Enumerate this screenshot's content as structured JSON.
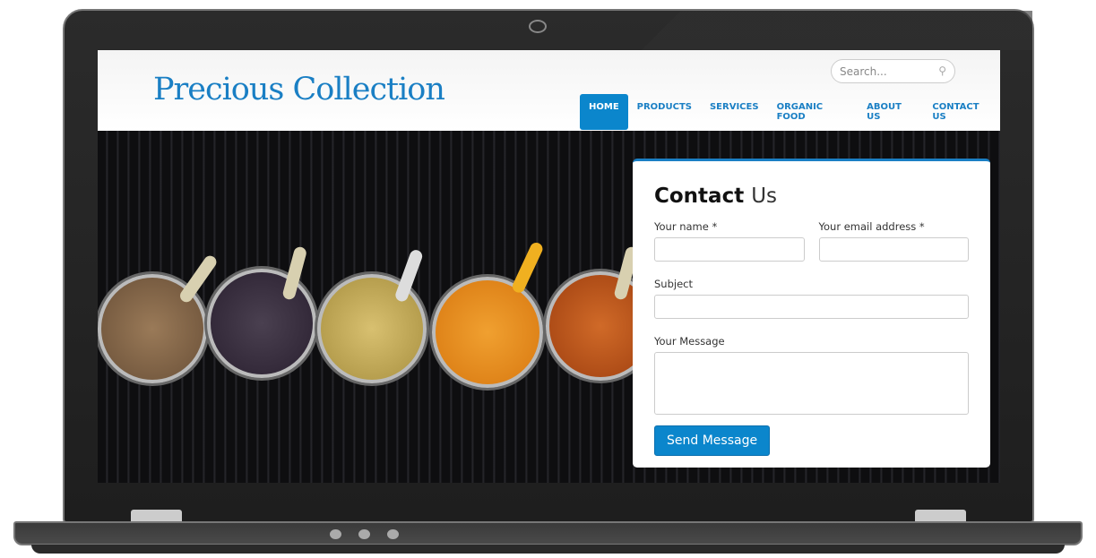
{
  "site": {
    "title": "Precious Collection"
  },
  "search": {
    "placeholder": "Search..."
  },
  "nav": [
    {
      "label": "HOME",
      "active": true
    },
    {
      "label": "PRODUCTS"
    },
    {
      "label": "SERVICES"
    },
    {
      "label": "ORGANIC FOOD"
    },
    {
      "label": "ABOUT US"
    },
    {
      "label": "CONTACT US"
    }
  ],
  "contact": {
    "title_bold": "Contact",
    "title_light": "Us",
    "name_label": "Your name *",
    "email_label": "Your email address *",
    "subject_label": "Subject",
    "message_label": "Your Message",
    "submit": "Send Message"
  },
  "colors": {
    "accent": "#0b86cc",
    "logo": "#1a7fc4"
  }
}
